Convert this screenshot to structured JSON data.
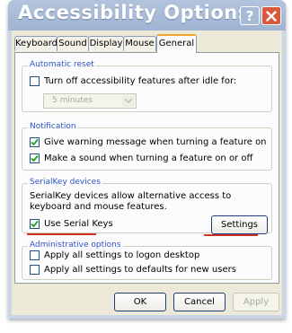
{
  "window": {
    "title": "Accessibility Options",
    "help_icon": "help-icon",
    "close_icon": "close-icon"
  },
  "tabs": [
    {
      "label": "Keyboard",
      "active": false
    },
    {
      "label": "Sound",
      "active": false
    },
    {
      "label": "Display",
      "active": false
    },
    {
      "label": "Mouse",
      "active": false
    },
    {
      "label": "General",
      "active": true
    }
  ],
  "automatic_reset": {
    "legend": "Automatic reset",
    "turn_off_label": "Turn off accessibility features after idle for:",
    "turn_off_checked": false,
    "idle_select_value": "5 minutes"
  },
  "notification": {
    "legend": "Notification",
    "warning_label": "Give warning message when turning a feature on",
    "warning_checked": true,
    "sound_label": "Make a sound when turning a feature on or off",
    "sound_checked": true
  },
  "serialkey": {
    "legend": "SerialKey devices",
    "description": "SerialKey devices allow alternative access to keyboard and mouse features.",
    "use_label": "Use Serial Keys",
    "use_checked": true,
    "settings_label": "Settings"
  },
  "admin": {
    "legend": "Administrative options",
    "logon_label": "Apply all settings to logon desktop",
    "logon_checked": false,
    "defaults_label": "Apply all settings to defaults for new users",
    "defaults_checked": false
  },
  "footer": {
    "ok_label": "OK",
    "cancel_label": "Cancel",
    "apply_label": "Apply"
  },
  "colors": {
    "accent_underline": "#d13024",
    "group_label": "#2e54c6",
    "close_button": "#d8593c",
    "active_tab_highlight": "#f0a52c"
  }
}
